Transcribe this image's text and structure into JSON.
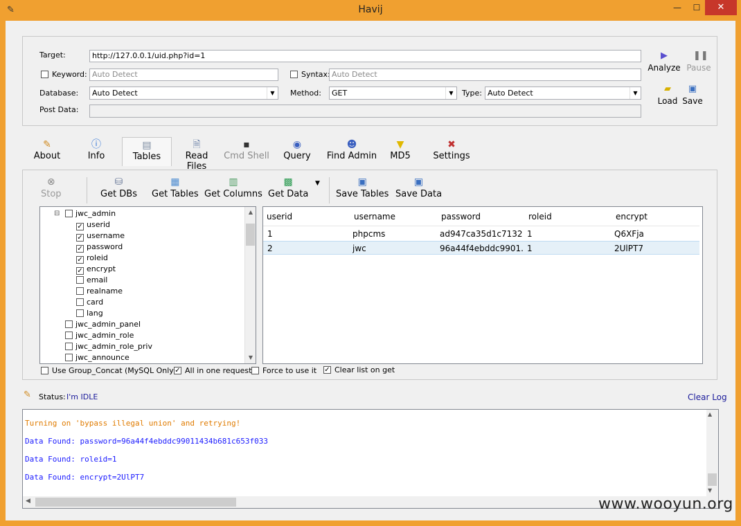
{
  "window": {
    "title": "Havij"
  },
  "target": {
    "target_label": "Target:",
    "target_value": "http://127.0.0.1/uid.php?id=1",
    "keyword_label": "Keyword:",
    "keyword_placeholder": "Auto Detect",
    "syntax_label": "Syntax:",
    "syntax_placeholder": "Auto Detect",
    "database_label": "Database:",
    "database_value": "Auto Detect",
    "method_label": "Method:",
    "method_value": "GET",
    "type_label": "Type:",
    "type_value": "Auto Detect",
    "postdata_label": "Post Data:"
  },
  "side_buttons": {
    "analyze": "Analyze",
    "pause": "Pause",
    "load": "Load",
    "save": "Save"
  },
  "tabs": [
    "About",
    "Info",
    "Tables",
    "Read Files",
    "Cmd Shell",
    "Query",
    "Find Admin",
    "MD5",
    "Settings"
  ],
  "toolbar": {
    "stop": "Stop",
    "get_dbs": "Get DBs",
    "get_tables": "Get Tables",
    "get_columns": "Get Columns",
    "get_data": "Get Data",
    "save_tables": "Save Tables",
    "save_data": "Save Data"
  },
  "tree": [
    {
      "label": "jwc_admin",
      "checked": false,
      "level": 0
    },
    {
      "label": "userid",
      "checked": true,
      "level": 1
    },
    {
      "label": "username",
      "checked": true,
      "level": 1
    },
    {
      "label": "password",
      "checked": true,
      "level": 1
    },
    {
      "label": "roleid",
      "checked": true,
      "level": 1
    },
    {
      "label": "encrypt",
      "checked": true,
      "level": 1
    },
    {
      "label": "email",
      "checked": false,
      "level": 1
    },
    {
      "label": "realname",
      "checked": false,
      "level": 1
    },
    {
      "label": "card",
      "checked": false,
      "level": 1
    },
    {
      "label": "lang",
      "checked": false,
      "level": 1
    },
    {
      "label": "jwc_admin_panel",
      "checked": false,
      "level": 0
    },
    {
      "label": "jwc_admin_role",
      "checked": false,
      "level": 0
    },
    {
      "label": "jwc_admin_role_priv",
      "checked": false,
      "level": 0
    },
    {
      "label": "jwc_announce",
      "checked": false,
      "level": 0
    }
  ],
  "grid": {
    "columns": [
      "userid",
      "username",
      "password",
      "roleid",
      "encrypt"
    ],
    "rows": [
      [
        "1",
        "phpcms",
        "ad947ca35d1c7132...",
        "1",
        "Q6XFja"
      ],
      [
        "2",
        "jwc",
        "96a44f4ebddc9901...",
        "1",
        "2UlPT7"
      ]
    ]
  },
  "options": {
    "group_concat": "Use Group_Concat (MySQL Only)",
    "all_in_one": "All in one request.",
    "force": "Force to use it",
    "clear_list": "Clear list on get"
  },
  "status": {
    "label": "Status:",
    "value": "I'm IDLE",
    "clear_log": "Clear Log"
  },
  "log": [
    {
      "text": "Turning on 'bypass illegal union' and retrying!",
      "color": "#e07b00"
    },
    {
      "text": "Data Found: password=96a44f4ebddc99011434b681c653f033",
      "color": "#1a1aff"
    },
    {
      "text": "Data Found: roleid=1",
      "color": "#1a1aff"
    },
    {
      "text": "Data Found: encrypt=2UlPT7",
      "color": "#1a1aff"
    }
  ],
  "watermark": "www.wooyun.org"
}
